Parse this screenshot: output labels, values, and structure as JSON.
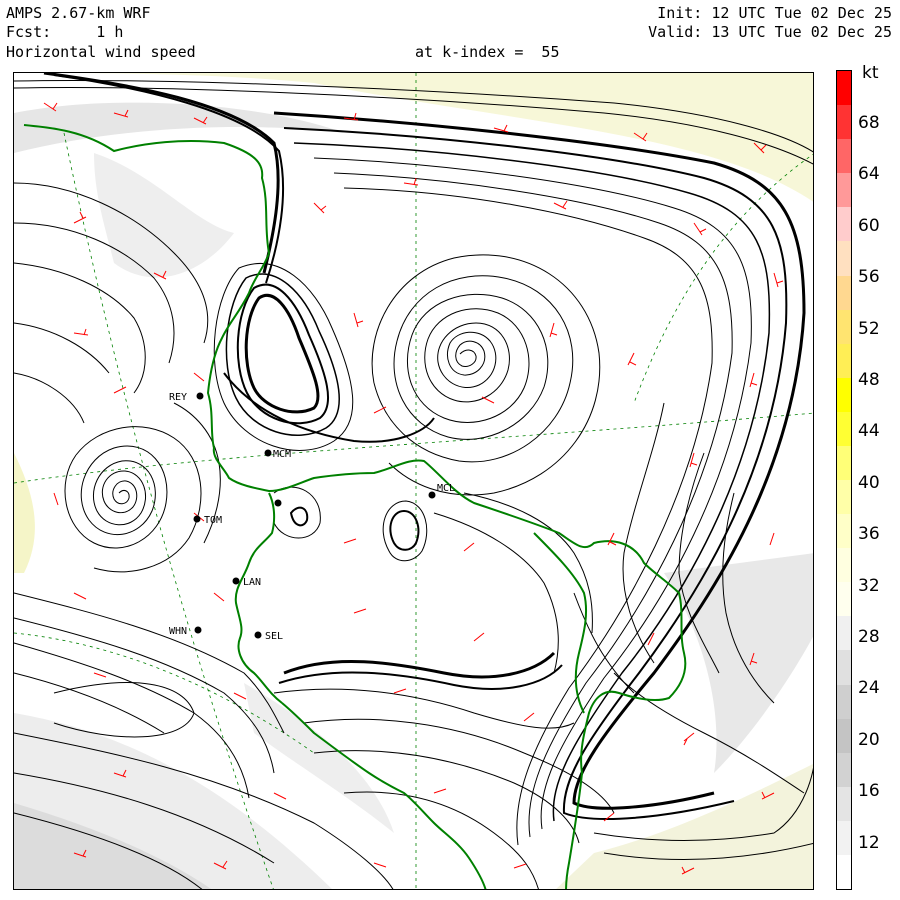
{
  "header": {
    "model": "AMPS 2.67-km WRF",
    "forecast": "Fcst:     1 h",
    "field": "Horizontal wind speed",
    "level": "at k-index =  55",
    "init": "Init: 12 UTC Tue 02 Dec 25",
    "valid": "Valid: 13 UTC Tue 02 Dec 25"
  },
  "colorbar": {
    "unit": "kt",
    "ticks": [
      "68",
      "64",
      "60",
      "56",
      "52",
      "48",
      "44",
      "40",
      "36",
      "32",
      "28",
      "24",
      "20",
      "16",
      "12"
    ],
    "colors": [
      "#ff0000",
      "#ff3333",
      "#ff6666",
      "#ff9999",
      "#ffcccc",
      "#ffe0c0",
      "#ffd890",
      "#ffe470",
      "#ffee55",
      "#ffff00",
      "#ffff33",
      "#ffff77",
      "#ffffa8",
      "#ffffc8",
      "#ffffe0",
      "#ffffee",
      "#f0f0f0",
      "#e0e0e0",
      "#cfcfcf",
      "#c4c4c4",
      "#d2d2d2",
      "#e4e4e4",
      "#f2f2f2",
      "#ffffff"
    ]
  },
  "stations": [
    {
      "code": "REY"
    },
    {
      "code": "MCM"
    },
    {
      "code": "TOM"
    },
    {
      "code": "MCL"
    },
    {
      "code": "LAN"
    },
    {
      "code": "WHN"
    },
    {
      "code": "SEL"
    }
  ],
  "colors": {
    "streamline": "#000000",
    "barb": "#ff0000",
    "coast": "#008000",
    "grid": "#008000"
  }
}
